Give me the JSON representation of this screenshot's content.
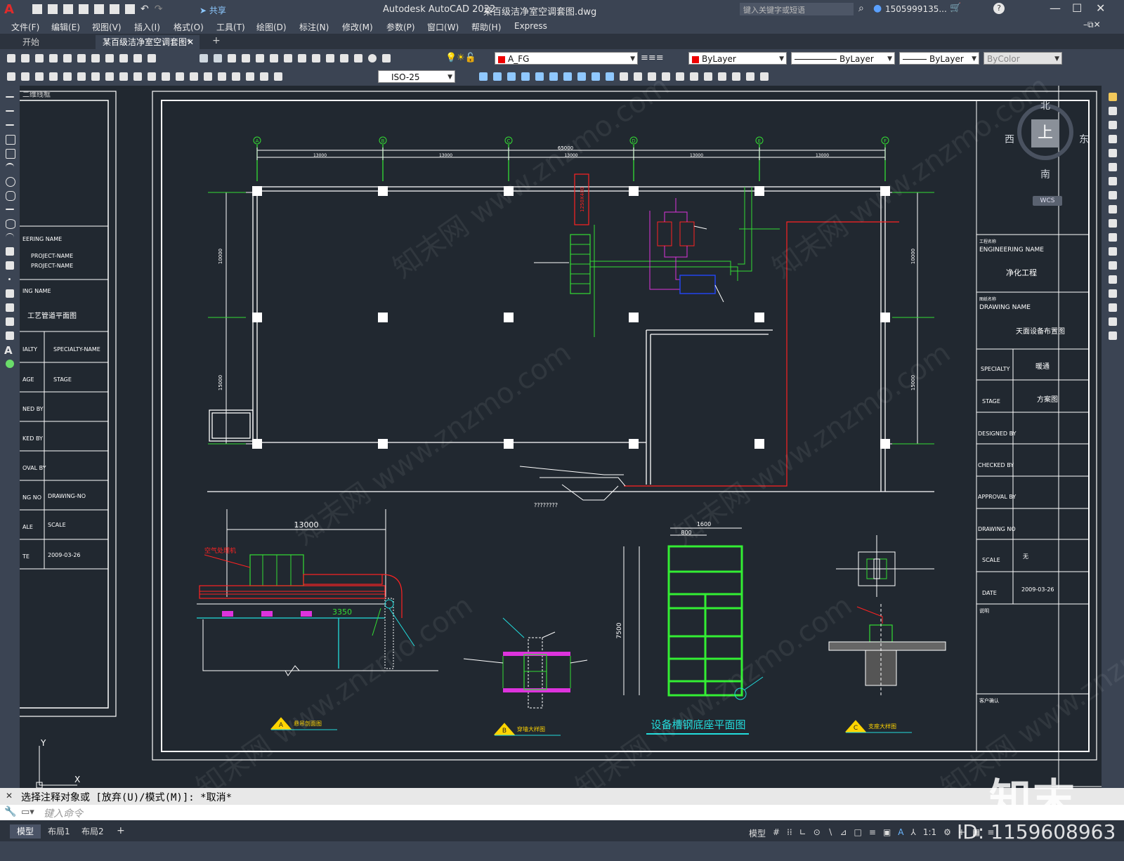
{
  "app": {
    "title": "Autodesk AutoCAD 2022",
    "file_title": "某百级洁净室空调套图.dwg",
    "search_placeholder": "键入关键字或短语",
    "user": "1505999135...",
    "share": "共享"
  },
  "menu": [
    "文件(F)",
    "编辑(E)",
    "视图(V)",
    "插入(I)",
    "格式(O)",
    "工具(T)",
    "绘图(D)",
    "标注(N)",
    "修改(M)",
    "参数(P)",
    "窗口(W)",
    "帮助(H)",
    "Express"
  ],
  "tabs": {
    "start": "开始",
    "doc": "某百级洁净室空调套图*"
  },
  "toolbar": {
    "layer": "A_FG",
    "color": "ByLayer",
    "linetype": "ByLayer",
    "lineweight": "ByLayer",
    "plotstyle": "ByColor",
    "dimstyle": "ISO-25",
    "layer_color": "#ff0000"
  },
  "viewcube": {
    "north": "北",
    "south": "南",
    "east": "东",
    "west": "西",
    "top": "上",
    "wcs": "WCS"
  },
  "drawing": {
    "grid_labels": [
      "A",
      "B",
      "C",
      "D",
      "E",
      "F"
    ],
    "top_dim_total": "65000",
    "top_dims": [
      "13000",
      "13000",
      "13000",
      "13000",
      "13000"
    ],
    "side_dims_left": [
      "10000",
      "15000"
    ],
    "side_dims_right": [
      "10000",
      "15000"
    ],
    "duct_label": "1250X400",
    "title_block": {
      "engineering_name_label": "ENGINEERING NAME",
      "engineering_name_cn": "工程名称",
      "engineering_value": "净化工程",
      "drawing_name_label": "DRAWING NAME",
      "drawing_name_cn": "图纸名称",
      "drawing_value": "天面设备布置图",
      "specialty_label": "SPECIALTY",
      "specialty_value": "暖通",
      "stage_label": "STAGE",
      "stage_value": "方案图",
      "designed_label": "DESIGNED BY",
      "checked_label": "CHECKED BY",
      "approval_label": "APPROVAL BY",
      "drawing_no_label": "DRAWING NO",
      "scale_label": "SCALE",
      "scale_value": "无",
      "date_label": "DATE",
      "date_value": "2009-03-26",
      "notes_label": "说明",
      "client_label": "客户确认"
    },
    "left_block": {
      "eng_name": "EERING NAME",
      "proj1": "PROJECT-NAME",
      "proj2": "PROJECT-NAME",
      "ing_name": "ING NAME",
      "drawing_cn": "工艺管道平面图",
      "ialty": "IALTY",
      "specialty_val": "SPECIALTY-NAME",
      "age": "AGE",
      "stage_val": "STAGE",
      "ned": "NED BY",
      "ked": "KED BY",
      "oval": "OVAL BY",
      "ng_no": "NG NO",
      "drawing_no_val": "DRAWING-NO",
      "ale": "ALE",
      "scale_val": "SCALE",
      "te": "TE",
      "date_val": "2009-03-26",
      "header": "二维线框"
    },
    "detail_dim_13000": "13000",
    "detail_dim_3350": "3350",
    "steel_dim_1600": "1600",
    "steel_dim_800": "800",
    "steel_dim_7500": "7500",
    "steel_title": "设备槽钢底座平面图",
    "detail_labels": [
      "悬吊剖面图",
      "穿墙大样图",
      "支座大样图"
    ],
    "detail_tags": [
      "A",
      "B",
      "C"
    ],
    "air_unit_label": "空气处理机",
    "unknown_text": "????????",
    "bottom_marks": [
      "Y",
      "X"
    ]
  },
  "command": {
    "history": "选择注释对象或 [放弃(U)/模式(M)]: *取消*",
    "placeholder": "键入命令"
  },
  "status": {
    "tabs": [
      "模型",
      "布局1",
      "布局2"
    ],
    "model_label": "模型",
    "scale": "1:1"
  },
  "overlay": {
    "brand": "知末",
    "id": "ID: 1159608963"
  }
}
